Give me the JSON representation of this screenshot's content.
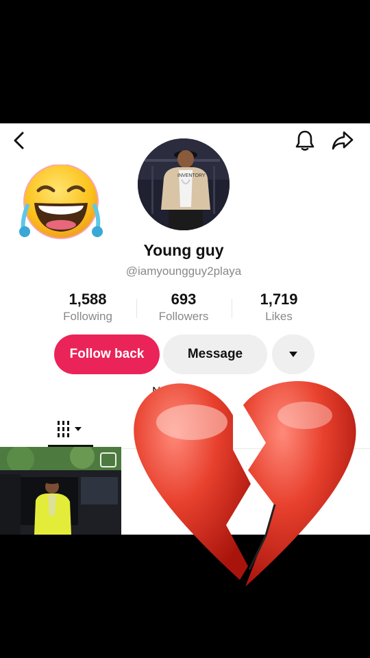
{
  "profile": {
    "name": "Young guy",
    "handle": "@iamyoungguy2playa",
    "avatar_shirt_text": "INVENTORY"
  },
  "stats": [
    {
      "value": "1,588",
      "label": "Following"
    },
    {
      "value": "693",
      "label": "Followers"
    },
    {
      "value": "1,719",
      "label": "Likes"
    }
  ],
  "actions": {
    "follow_back": "Follow back",
    "message": "Message"
  },
  "partial_text": "N",
  "icons": {
    "back": "back-arrow-icon",
    "bell": "bell-icon",
    "share": "share-icon",
    "more": "caret-down-icon",
    "grid": "grid-icon",
    "overlay_emoji": "laughing-crying-emoji",
    "overlay_heart": "broken-heart-emoji"
  },
  "colors": {
    "accent": "#ea2458",
    "button_gray": "#efefef",
    "muted_text": "#888888",
    "letterbox": "#000000"
  }
}
